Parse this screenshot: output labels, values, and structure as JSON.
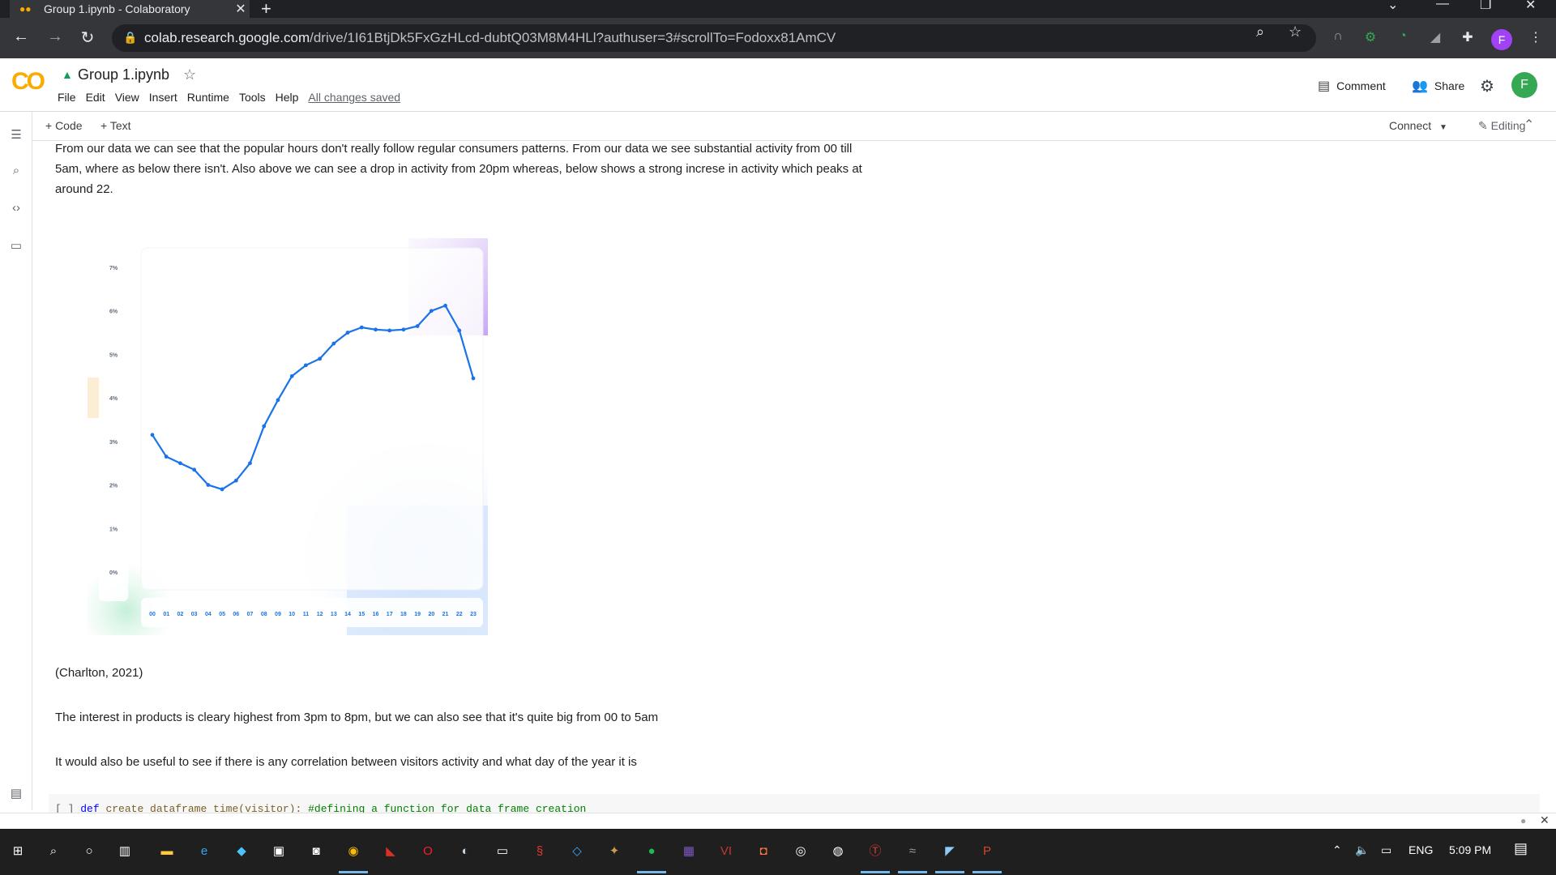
{
  "browser": {
    "tab_title": "Group 1.ipynb - Colaboratory",
    "url_host": "colab.research.google.com",
    "url_path": "/drive/1I61BtjDk5FxGzHLcd-dubtQ03M8M4HLl?authuser=3#scrollTo=Fodoxx81AmCV",
    "profile_initial": "F"
  },
  "colab": {
    "logo": "CO",
    "notebook_title": "Group 1.ipynb",
    "menu": [
      "File",
      "Edit",
      "View",
      "Insert",
      "Runtime",
      "Tools",
      "Help"
    ],
    "save_status": "All changes saved",
    "comment_label": "Comment",
    "share_label": "Share",
    "user_initial": "F",
    "add_code_label": "+ Code",
    "add_text_label": "+ Text",
    "connect_label": "Connect",
    "editing_label": "Editing"
  },
  "notebook": {
    "paragraph_1": "From our data we can see that the popular hours don't really follow regular consumers patterns. From our data we see substantial activity from 00 till 5am, where as below there isn't. Also above we can see a drop in activity from 20pm whereas, below shows a strong increse in activity which peaks at around 22.",
    "citation": "(Charlton, 2021)",
    "paragraph_2": "The interest in products is cleary highest from 3pm to 8pm, but we can also see that it's quite big from 00 to 5am",
    "paragraph_3": "It would also be useful to see if there is any correlation between visitors activity and what day of the year it is",
    "code_bracket": "[ ]",
    "code_kw": "def",
    "code_fn": "create_dataframe_time(visitor):",
    "code_comment": "#defining a function for data frame creation"
  },
  "chart_data": {
    "type": "line",
    "categories": [
      "00",
      "01",
      "02",
      "03",
      "04",
      "05",
      "06",
      "07",
      "08",
      "09",
      "10",
      "11",
      "12",
      "13",
      "14",
      "15",
      "16",
      "17",
      "18",
      "19",
      "20",
      "21",
      "22",
      "23"
    ],
    "values": [
      3.15,
      2.65,
      2.5,
      2.35,
      2.0,
      1.9,
      2.1,
      2.5,
      3.35,
      3.95,
      4.5,
      4.75,
      4.9,
      5.25,
      5.5,
      5.62,
      5.57,
      5.55,
      5.57,
      5.65,
      6.0,
      6.12,
      5.55,
      4.45
    ],
    "y_ticks": [
      "7%",
      "6%",
      "5%",
      "4%",
      "3%",
      "2%",
      "1%",
      "0%"
    ],
    "ylim": [
      0,
      7
    ],
    "line_color": "#1a73e8"
  },
  "taskbar": {
    "language": "ENG",
    "time": "5:09 PM"
  }
}
